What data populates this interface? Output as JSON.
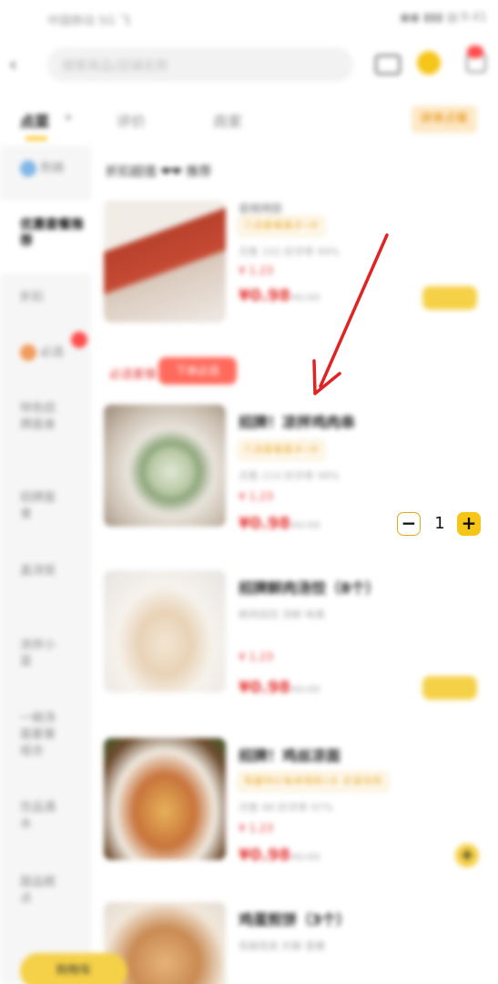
{
  "status_bar": {
    "carrier": "中国移动 5G 飞",
    "icons": "◼◼ ▮▮▮ ▤",
    "time": "9:41"
  },
  "header": {
    "search_placeholder": "搜索商品/店铺名称",
    "icons": [
      "back-arrow-icon",
      "cart-icon",
      "star-icon",
      "message-icon"
    ]
  },
  "tabs": [
    {
      "label": "点菜",
      "active": true
    },
    {
      "label": "评价",
      "active": false
    },
    {
      "label": "商家",
      "active": false
    }
  ],
  "tabs_extra": {
    "caret": "▾",
    "pill": "拼单点餐"
  },
  "sidebar": {
    "items": [
      {
        "label": "热销",
        "icon_color": "#7fb6e8"
      },
      {
        "label": "优惠套餐推荐",
        "icon_color": ""
      },
      {
        "label": "折扣",
        "icon_color": ""
      },
      {
        "label": "必选",
        "icon_color": "#f39a5a"
      },
      {
        "label": "特色招牌面食",
        "icon_color": ""
      },
      {
        "label": "招牌面食",
        "icon_color": ""
      },
      {
        "label": "盖浇饭",
        "icon_color": ""
      },
      {
        "label": "凉拌小菜",
        "icon_color": ""
      },
      {
        "label": "一碗汤面套餐组合",
        "icon_color": ""
      },
      {
        "label": "饮品酒水",
        "icon_color": ""
      },
      {
        "label": "甜品糕点",
        "icon_color": ""
      }
    ]
  },
  "content": {
    "section1_title": "折扣超值 ❤❤ 推荐",
    "section2_tag": "必选套餐",
    "section2_pill": "下单必选",
    "products": [
      {
        "name": "香辣烤肠",
        "tag": "已选套餐最多1份",
        "meta": "月售 102  好评率 99%",
        "vip_price": "¥ 1.23",
        "price": "¥0.98",
        "original": "¥2.50",
        "button": "选规格"
      },
      {
        "name": "招牌！凉拌鸡肉串",
        "tag": "已选套餐最多1份",
        "meta": "月售 214  好评率 98%",
        "vip_price": "¥ 1.23",
        "price": "¥0.98",
        "original": "¥2.50",
        "quantity": "1",
        "minus_label": "−",
        "plus_label": "+"
      },
      {
        "name": "招牌鲜肉汤饺（8个）",
        "tag": "",
        "meta": "鲜肉馅饺   汤鲜   味美",
        "vip_price": "¥ 1.23",
        "price": "¥0.98",
        "original": "¥2.50",
        "button": "选规格"
      },
      {
        "name": "招牌！鸡丝凉面",
        "tag": "限量特价每单限购1份 赶紧抢购",
        "meta": "月售 88  好评率 97%",
        "vip_price": "¥ 1.23",
        "price": "¥0.98",
        "original": "¥2.50",
        "plus": "+"
      },
      {
        "name": "鸡蛋煎饼（3个）",
        "tag": "",
        "meta": "现做现卖   外酥   里嫩",
        "vip_price": "",
        "price": "",
        "original": ""
      }
    ]
  },
  "bottom": {
    "cart_label": "购物车"
  },
  "colors": {
    "accent": "#f5c518",
    "price": "#e53935",
    "annotation": "#e02424"
  }
}
